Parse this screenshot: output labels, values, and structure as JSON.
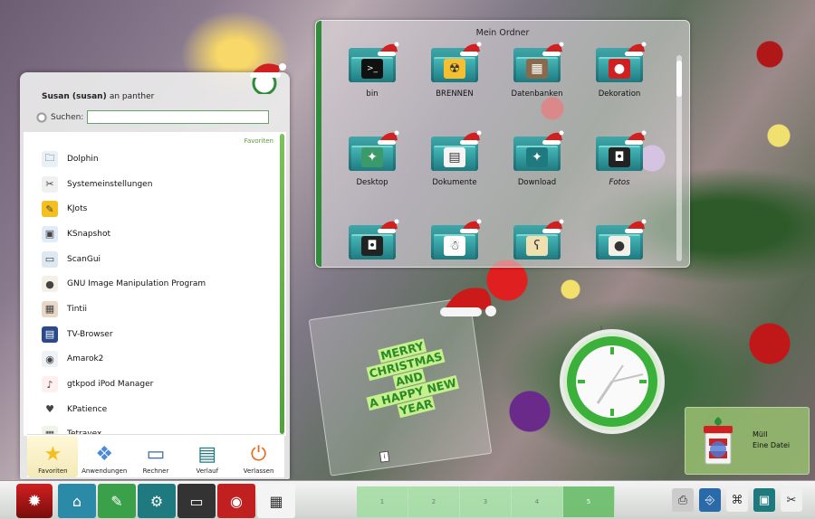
{
  "menu": {
    "user_name": "Susan (susan)",
    "user_suffix": "an panther",
    "search_label": "Suchen:",
    "search_value": "",
    "favorites_header": "Favoriten",
    "items": [
      {
        "label": "Dolphin",
        "icon": "folder-icon"
      },
      {
        "label": "Systemeinstellungen",
        "icon": "tools-icon"
      },
      {
        "label": "KJots",
        "icon": "notes-icon"
      },
      {
        "label": "KSnapshot",
        "icon": "screenshot-icon"
      },
      {
        "label": "ScanGui",
        "icon": "scanner-icon"
      },
      {
        "label": "GNU Image Manipulation Program",
        "icon": "gimp-icon"
      },
      {
        "label": "Tintii",
        "icon": "image-icon"
      },
      {
        "label": "TV-Browser",
        "icon": "tv-icon"
      },
      {
        "label": "Amarok2",
        "icon": "amarok-icon"
      },
      {
        "label": "gtkpod iPod Manager",
        "icon": "ipod-icon"
      },
      {
        "label": "KPatience",
        "icon": "cards-icon"
      },
      {
        "label": "Tetravex",
        "icon": "puzzle-icon"
      }
    ],
    "tabs": [
      {
        "label": "Favoriten",
        "icon": "star-icon",
        "active": true
      },
      {
        "label": "Anwendungen",
        "icon": "applications-icon",
        "active": false
      },
      {
        "label": "Rechner",
        "icon": "computer-icon",
        "active": false
      },
      {
        "label": "Verlauf",
        "icon": "history-icon",
        "active": false
      },
      {
        "label": "Verlassen",
        "icon": "power-icon",
        "active": false
      }
    ]
  },
  "folder": {
    "title": "Mein Ordner",
    "items": [
      {
        "label": "bin",
        "icon": "terminal-icon"
      },
      {
        "label": "BRENNEN",
        "icon": "burn-icon"
      },
      {
        "label": "Datenbanken",
        "icon": "database-icon"
      },
      {
        "label": "Dekoration",
        "icon": "ornament-icon"
      },
      {
        "label": "Desktop",
        "icon": "desktop-icon"
      },
      {
        "label": "Dokumente",
        "icon": "documents-icon"
      },
      {
        "label": "Download",
        "icon": "download-icon"
      },
      {
        "label": "Fotos",
        "icon": "camera-icon",
        "italic": true
      },
      {
        "label": "",
        "icon": "camera-icon"
      },
      {
        "label": "",
        "icon": "snowman-icon"
      },
      {
        "label": "",
        "icon": "teddy-icon"
      },
      {
        "label": "",
        "icon": "gimp-icon"
      }
    ]
  },
  "note": {
    "line1": "MERRY",
    "line2": "CHRISTMAS",
    "line3": "AND",
    "line4": "A HAPPY NEW",
    "line5": "YEAR"
  },
  "trash": {
    "title": "Müll",
    "subtitle": "Eine Datei"
  },
  "taskbar": {
    "pages": [
      "1",
      "2",
      "3",
      "4",
      "5"
    ],
    "active_page": "5",
    "launchers": [
      "home-icon",
      "pen-icon",
      "gear-icon",
      "monitor-icon",
      "media-icon",
      "calendar-icon"
    ],
    "tray": [
      "printer-icon",
      "usb-icon",
      "gift-icon",
      "screen-icon",
      "tools-icon"
    ]
  },
  "colors": {
    "accent_green": "#2e8c3a",
    "folder_teal": "#1f7a80",
    "santa_red": "#d02020"
  }
}
